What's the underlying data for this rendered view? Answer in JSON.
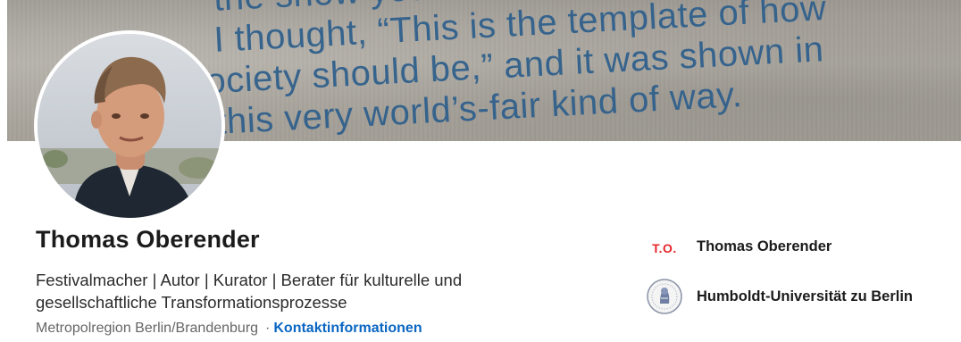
{
  "banner": {
    "lines": [
      "the show you were",
      "I thought, “This is the template of how",
      "society should be,” and it was shown in",
      "this very world’s-fair kind of way."
    ]
  },
  "profile": {
    "name": "Thomas Oberender",
    "headline": "Festivalmacher | Autor | Kurator | Berater für kulturelle und gesellschaftliche Transformationsprozesse",
    "location": "Metropolregion Berlin/Brandenburg",
    "separator": "·",
    "contact_link": "Kontaktinformationen"
  },
  "organizations": [
    {
      "logo_text": "T.O.",
      "name": "Thomas Oberender",
      "icon": "to-logo-icon"
    },
    {
      "logo_text": "",
      "name": "Humboldt-Universität zu Berlin",
      "icon": "university-seal-icon"
    }
  ],
  "colors": {
    "link": "#0a66c2",
    "logo_red": "#e5252a",
    "banner_text": "#2e5f8c",
    "name_text": "#1b1b1b"
  }
}
